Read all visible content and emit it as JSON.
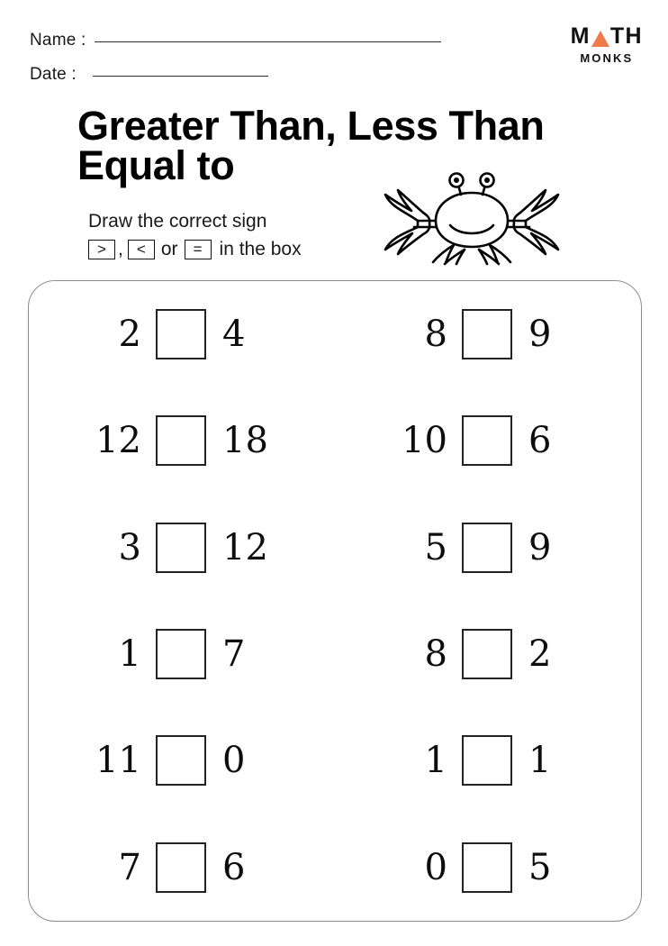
{
  "header": {
    "name_label": "Name :",
    "date_label": "Date :"
  },
  "logo": {
    "word_m": "M",
    "word_th": "TH",
    "subtitle": "MONKS",
    "triangle_color": "#ef7b4d"
  },
  "title": "Greater Than,  Less Than\nEqual to",
  "instructions": {
    "line1": "Draw the correct sign",
    "sign_greater": ">",
    "separator": ",",
    "sign_less": "<",
    "conjunction": "or",
    "sign_equal": "=",
    "tail": "in the box"
  },
  "illustration": {
    "name": "crab"
  },
  "problems": [
    {
      "left": "2",
      "right": "4",
      "answer": ""
    },
    {
      "left": "8",
      "right": "9",
      "answer": ""
    },
    {
      "left": "12",
      "right": "18",
      "answer": ""
    },
    {
      "left": "10",
      "right": "6",
      "answer": ""
    },
    {
      "left": "3",
      "right": "12",
      "answer": ""
    },
    {
      "left": "5",
      "right": "9",
      "answer": ""
    },
    {
      "left": "1",
      "right": "7",
      "answer": ""
    },
    {
      "left": "8",
      "right": "2",
      "answer": ""
    },
    {
      "left": "11",
      "right": "0",
      "answer": ""
    },
    {
      "left": "1",
      "right": "1",
      "answer": ""
    },
    {
      "left": "7",
      "right": "6",
      "answer": ""
    },
    {
      "left": "0",
      "right": "5",
      "answer": ""
    }
  ]
}
